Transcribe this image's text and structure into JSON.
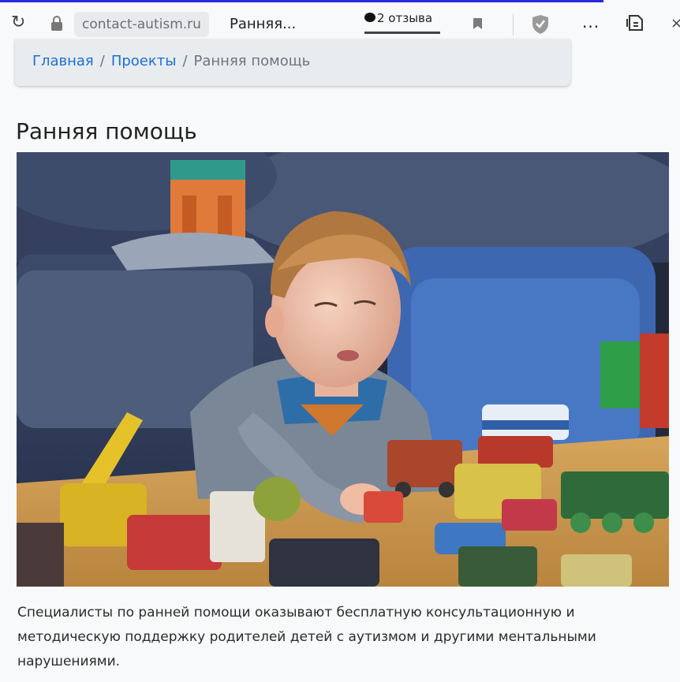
{
  "browser": {
    "domain": "contact-autism.ru",
    "tab_title": "Ранняя...",
    "reviews_label": "2 отзыва",
    "more_label": "...",
    "icons": {
      "reload": "reload-icon",
      "lock": "lock-icon",
      "reviews": "speech-bubble-icon",
      "bookmark": "bookmark-icon",
      "protect": "shield-icon",
      "more": "more-icon",
      "tabs": "tab-manager-icon"
    }
  },
  "breadcrumb": {
    "items": [
      {
        "label": "Главная"
      },
      {
        "label": "Проекты"
      }
    ],
    "separator": "/",
    "current": "Ранняя помощь"
  },
  "page": {
    "title": "Ранняя помощь",
    "description": "Специалисты по ранней помощи оказывают бесплатную консультационную и методическую поддержку родителей детей с аутизмом и другими ментальными нарушениями."
  },
  "colors": {
    "link": "#1a6fd6",
    "breadcrumb_bg": "#e9ecef",
    "page_bg": "#f8f9fa",
    "top_accent": "#2a2ad8"
  }
}
